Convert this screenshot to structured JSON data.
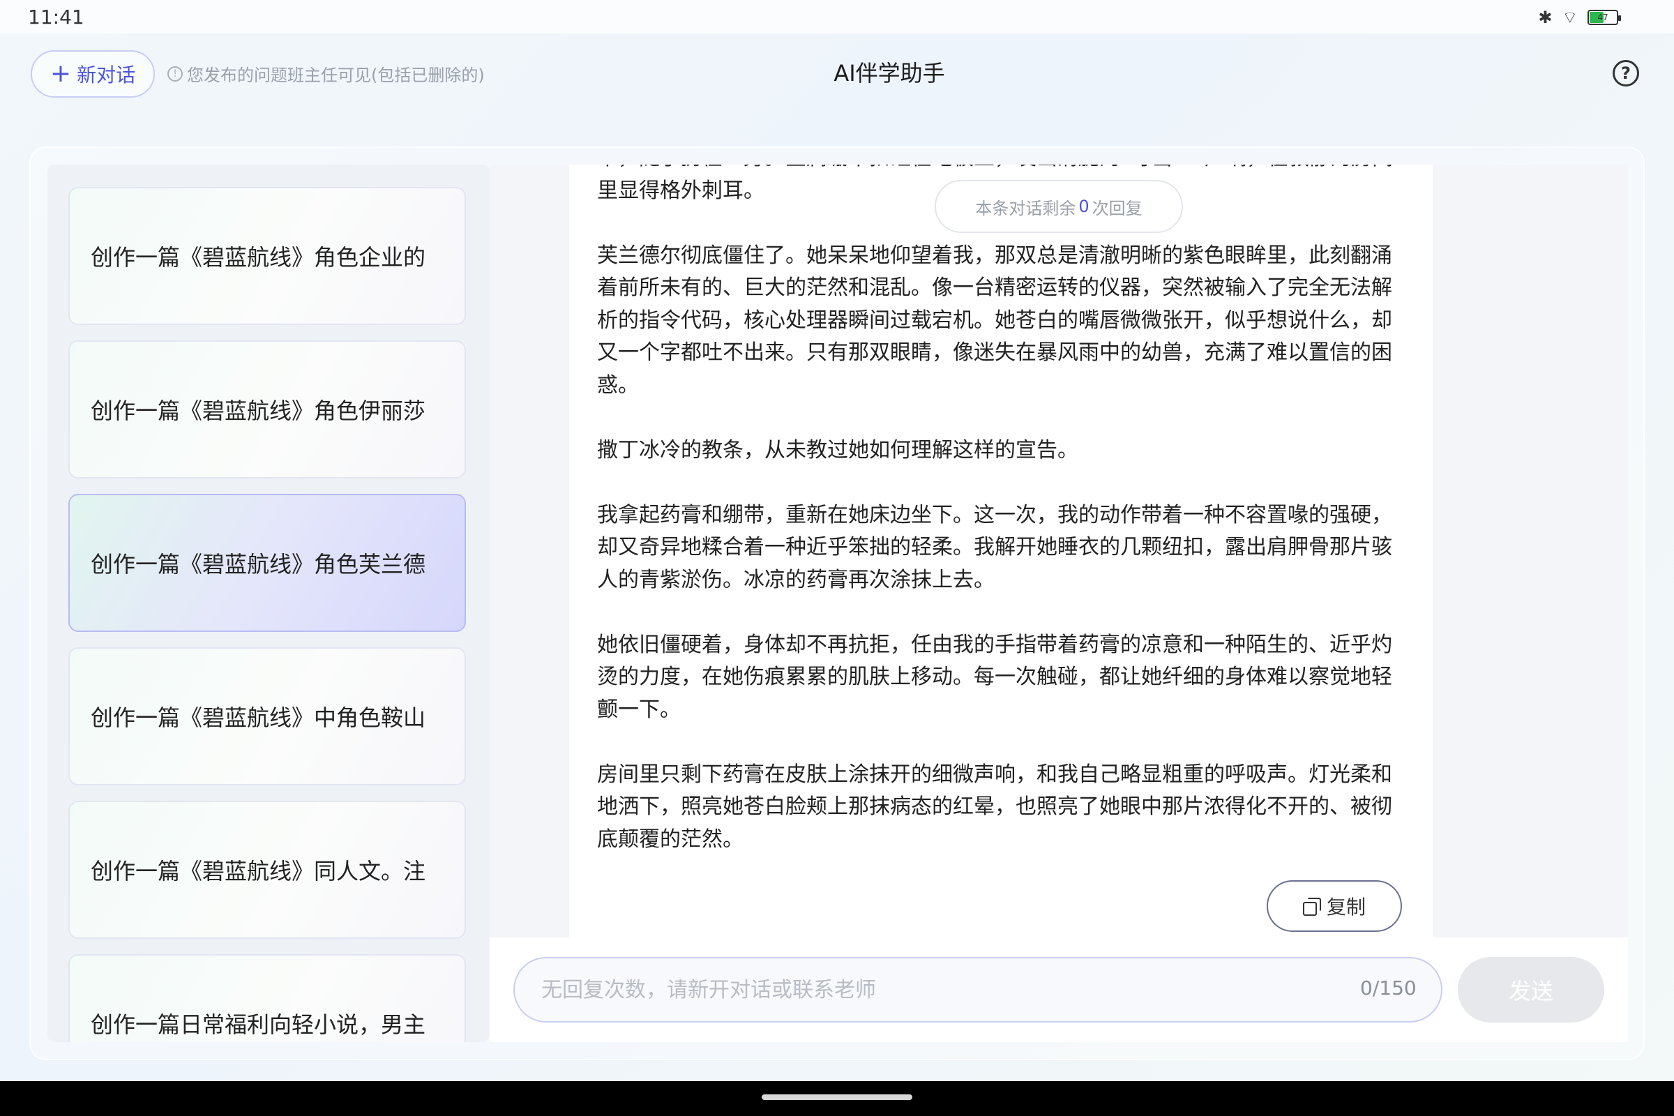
{
  "status_bar": {
    "time": "11:41",
    "battery_level": "47",
    "bluetooth_icon": "bluetooth-icon",
    "wifi_icon": "wifi-icon"
  },
  "header": {
    "new_chat_label": "新对话",
    "notice": "您发布的问题班主任可见(包括已删除的)",
    "title": "AI伴学助手",
    "help": "?"
  },
  "sidebar": {
    "items": [
      {
        "label": "创作一篇《碧蓝航线》角色企业的"
      },
      {
        "label": "创作一篇《碧蓝航线》角色伊丽莎"
      },
      {
        "label": "创作一篇《碧蓝航线》角色芙兰德"
      },
      {
        "label": "创作一篇《碧蓝航线》中角色鞍山"
      },
      {
        "label": "创作一篇《碧蓝航线》同人文。注"
      },
      {
        "label": "创作一篇日常福利向轻小说，男主"
      }
    ],
    "active_index": 2
  },
  "chat": {
    "remain": {
      "prefix": "本条对话剩余",
      "count": "0",
      "suffix": "次回复"
    },
    "paragraphs": [
      "带，随手扔在一旁。金属绷带扣砸在地板上，发出清脆的“叮当”一声响，在寂静的房间里显得格外刺耳。",
      "芙兰德尔彻底僵住了。她呆呆地仰望着我，那双总是清澈明晰的紫色眼眸里，此刻翻涌着前所未有的、巨大的茫然和混乱。像一台精密运转的仪器，突然被输入了完全无法解析的指令代码，核心处理器瞬间过载宕机。她苍白的嘴唇微微张开，似乎想说什么，却又一个字都吐不出来。只有那双眼睛，像迷失在暴风雨中的幼兽，充满了难以置信的困惑。",
      "撒丁冰冷的教条，从未教过她如何理解这样的宣告。",
      "我拿起药膏和绷带，重新在她床边坐下。这一次，我的动作带着一种不容置喙的强硬，却又奇异地糅合着一种近乎笨拙的轻柔。我解开她睡衣的几颗纽扣，露出肩胛骨那片骇人的青紫淤伤。冰凉的药膏再次涂抹上去。",
      "她依旧僵硬着，身体却不再抗拒，任由我的手指带着药膏的凉意和一种陌生的、近乎灼烫的力度，在她伤痕累累的肌肤上移动。每一次触碰，都让她纤细的身体难以察觉地轻颤一下。",
      "房间里只剩下药膏在皮肤上涂抹开的细微声响，和我自己略显粗重的呼吸声。灯光柔和地洒下，照亮她苍白脸颊上那抹病态的红晕，也照亮了她眼中那片浓得化不开的、被彻底颠覆的茫然。"
    ],
    "copy_label": "复制"
  },
  "input": {
    "placeholder": "无回复次数，请新开对话或联系老师",
    "counter": "0/150",
    "send_label": "发送"
  }
}
